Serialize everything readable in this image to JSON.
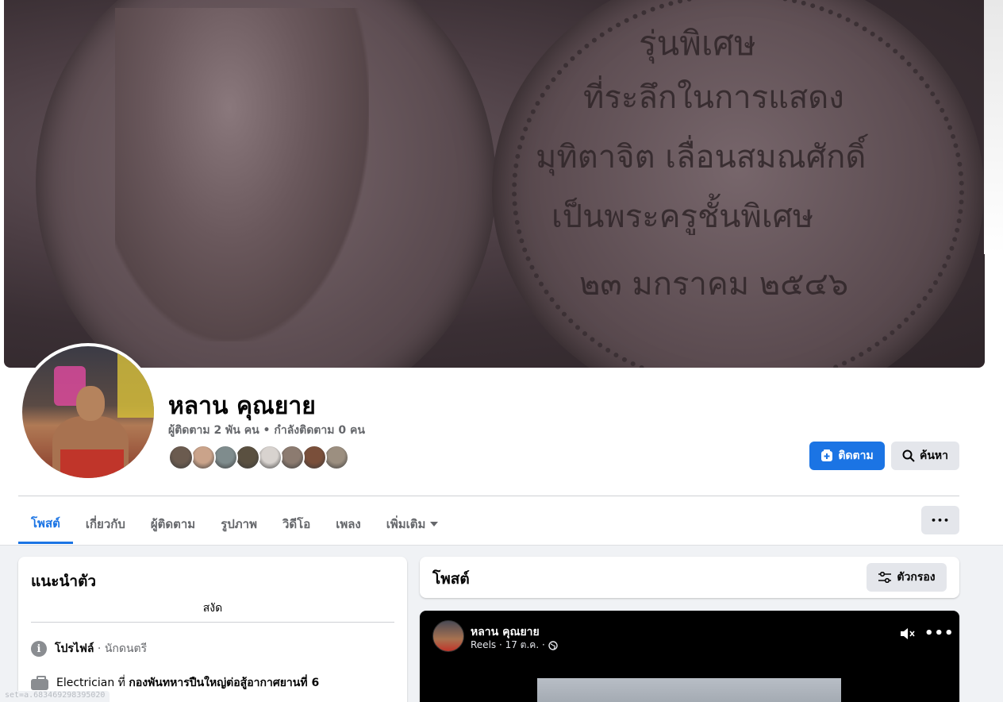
{
  "cover": {
    "lines": [
      "รุ่นพิเศษ",
      "ที่ระลึกในการแสดง",
      "มุทิตาจิต  เลื่อนสมณศักดิ์",
      "เป็นพระครูชั้นพิเศษ",
      "๒๓ มกราคม ๒๕๔๖"
    ]
  },
  "profile": {
    "name": "หลาน คุณยาย",
    "stats": "ผู้ติดตาม 2 พัน คน • กำลังติดตาม 0 คน",
    "friend_colors": [
      "#6b5b4f",
      "#caa38a",
      "#7f8c8d",
      "#5a5040",
      "#d8d3cf",
      "#8c7b70",
      "#7a4f3a",
      "#9c8f80"
    ]
  },
  "actions": {
    "follow_label": "ติดตาม",
    "search_label": "ค้นหา",
    "more_label": "•••",
    "follow_color": "#1b74e4"
  },
  "tabs": [
    {
      "label": "โพสต์"
    },
    {
      "label": "เกี่ยวกับ"
    },
    {
      "label": "ผู้ติดตาม"
    },
    {
      "label": "รูปภาพ"
    },
    {
      "label": "วิดีโอ"
    },
    {
      "label": "เพลง"
    },
    {
      "label": "เพิ่มเติม"
    }
  ],
  "intro": {
    "title": "แนะนำตัว",
    "bio": "สงัด",
    "profile_label": "โปรไฟล์",
    "profile_sep": " · ",
    "profile_category": "นักดนตรี",
    "work_prefix": "Electrician ที่ ",
    "work_place": "กองพันทหารปืนใหญ่ต่อสู้อากาศยานที่ 6"
  },
  "posts": {
    "title": "โพสต์",
    "filter_label": "ตัวกรอง"
  },
  "reel": {
    "author": "หลาน คุณยาย",
    "meta": "Reels · 17 ต.ค. ·",
    "more_label": "•••"
  },
  "status_url": "set=a.683469298395020",
  "icons": {
    "follow": "plus-square-icon",
    "search": "search-icon",
    "filter": "sliders-icon",
    "info": "info-icon",
    "work": "briefcase-icon",
    "globe": "globe-icon",
    "mute": "speaker-muted-icon",
    "dropdown": "caret-down-icon"
  }
}
